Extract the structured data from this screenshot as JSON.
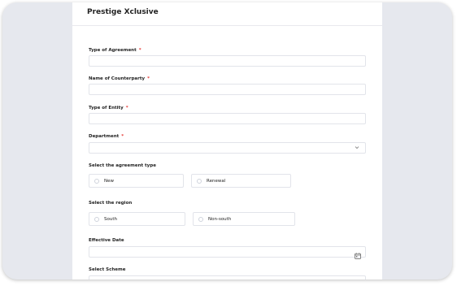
{
  "header": {
    "title": "Prestige Xclusive"
  },
  "fields": {
    "type_of_agreement": {
      "label": "Type of Agreement",
      "required": "*",
      "value": ""
    },
    "name_of_counterparty": {
      "label": "Name of Counterparty",
      "required": "*",
      "value": ""
    },
    "type_of_entity": {
      "label": "Type of Entity",
      "required": "*",
      "value": ""
    },
    "department": {
      "label": "Department",
      "required": "*",
      "value": "",
      "icon": "chevron-down-icon"
    },
    "agreement_type": {
      "label": "Select the agreement type",
      "options": [
        "New",
        "Renewal"
      ]
    },
    "region": {
      "label": "Select the region",
      "options": [
        "South",
        "Non-south"
      ]
    },
    "effective_date": {
      "label": "Effective Date",
      "value": "",
      "icon": "calendar-icon"
    },
    "select_scheme": {
      "label": "Select Scheme"
    }
  },
  "colors": {
    "required": "#e53935",
    "frame": "#e6e8ee",
    "border": "#e2e4ea"
  }
}
